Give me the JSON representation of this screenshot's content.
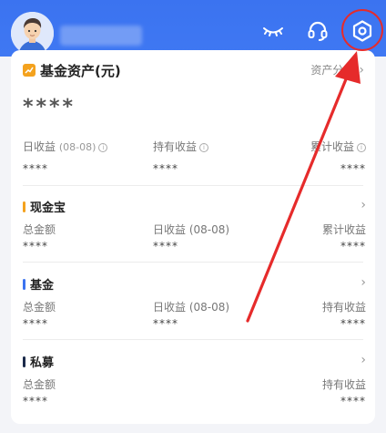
{
  "header": {
    "icons": [
      "eye-closed-icon",
      "headset-icon",
      "settings-icon"
    ],
    "brand_color": "#3b73f0"
  },
  "fund_assets": {
    "title": "基金资产(元)",
    "link_label": "资产分析",
    "total_value": "****",
    "items": [
      {
        "label": "日收益",
        "date": "(08-08)",
        "value": "****"
      },
      {
        "label": "持有收益",
        "value": "****"
      },
      {
        "label": "累计收益",
        "value": "****"
      }
    ]
  },
  "sections": [
    {
      "title": "现金宝",
      "color": "#f4a21e",
      "labels": [
        "总金额",
        "日收益 (08-08)",
        "累计收益"
      ],
      "values": [
        "****",
        "****",
        "****"
      ]
    },
    {
      "title": "基金",
      "color": "#3b73f0",
      "labels": [
        "总金额",
        "日收益 (08-08)",
        "持有收益"
      ],
      "values": [
        "****",
        "****",
        "****"
      ]
    },
    {
      "title": "私募",
      "color": "#1b2a4a",
      "labels": [
        "总金额",
        "持有收益"
      ],
      "values": [
        "****",
        "****"
      ]
    }
  ],
  "annotation": {
    "color": "#e62b2b"
  }
}
